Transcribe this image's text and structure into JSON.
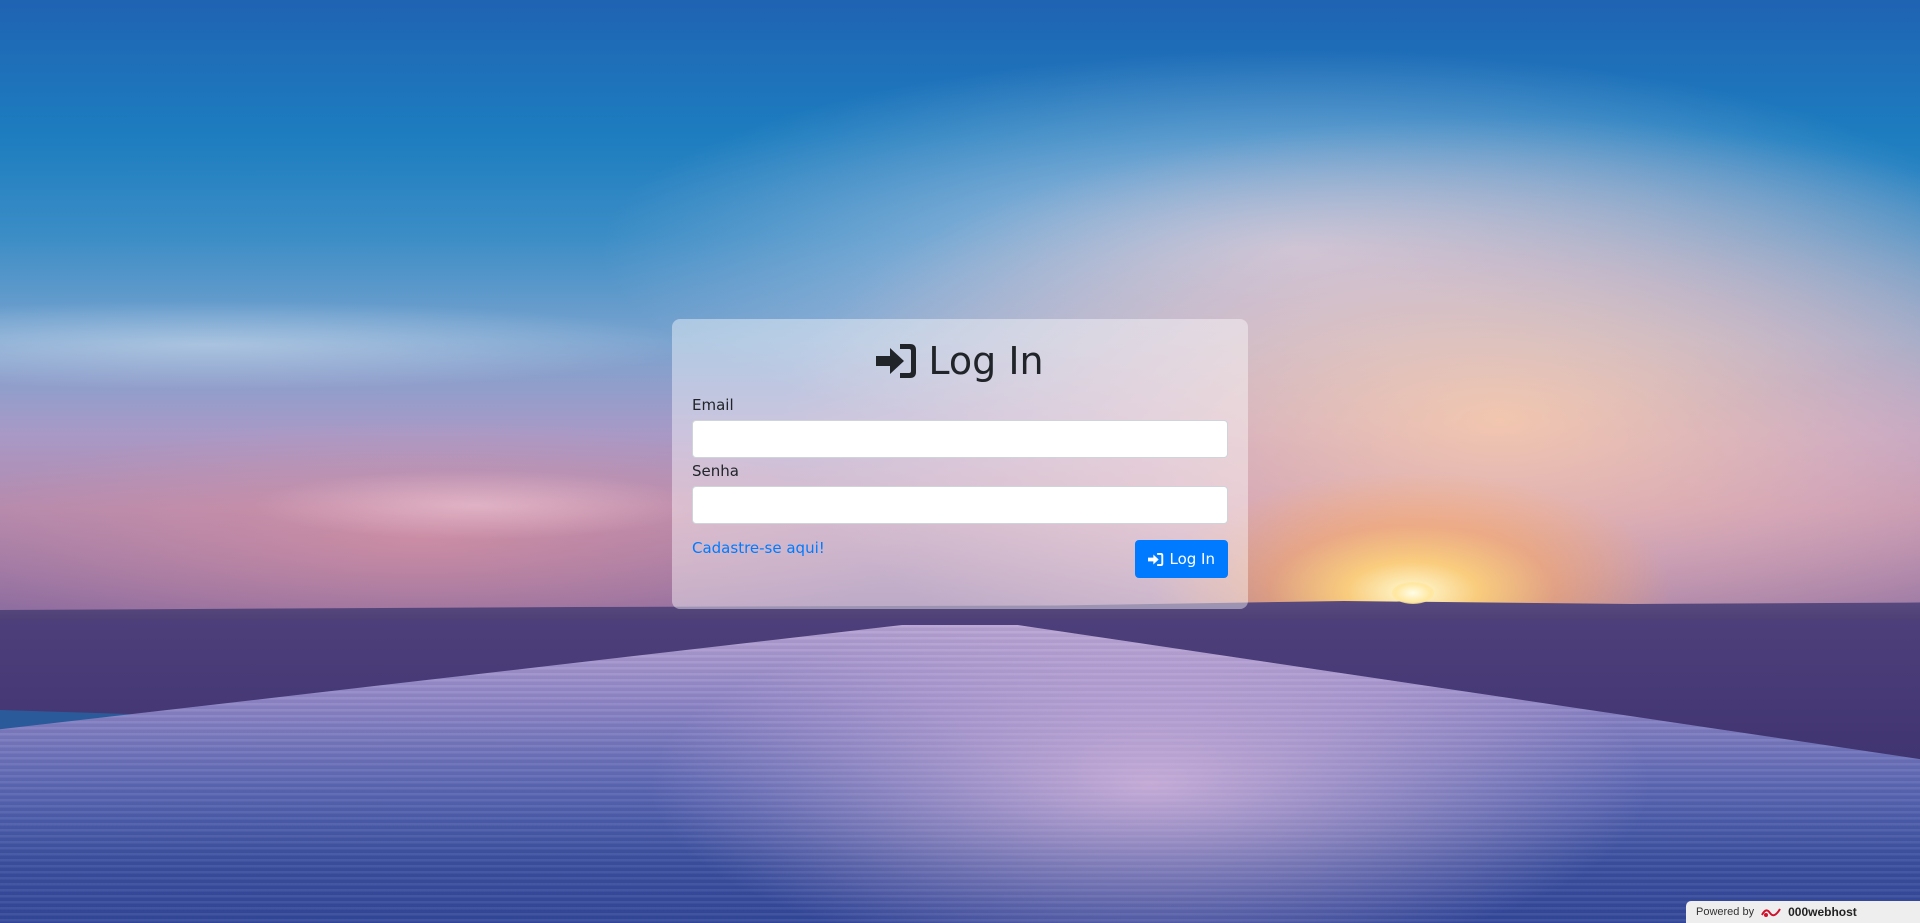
{
  "login": {
    "title": "Log In",
    "email_label": "Email",
    "email_value": "",
    "password_label": "Senha",
    "password_value": "",
    "register_link": "Cadastre-se aqui!",
    "submit_label": "Log In",
    "title_icon": "sign-in-icon",
    "button_icon": "sign-in-icon"
  },
  "footer": {
    "powered_by": "Powered by",
    "brand": "000webhost",
    "logo_icon": "000webhost-logo-icon"
  },
  "colors": {
    "primary": "#007bff",
    "text": "#212529"
  }
}
